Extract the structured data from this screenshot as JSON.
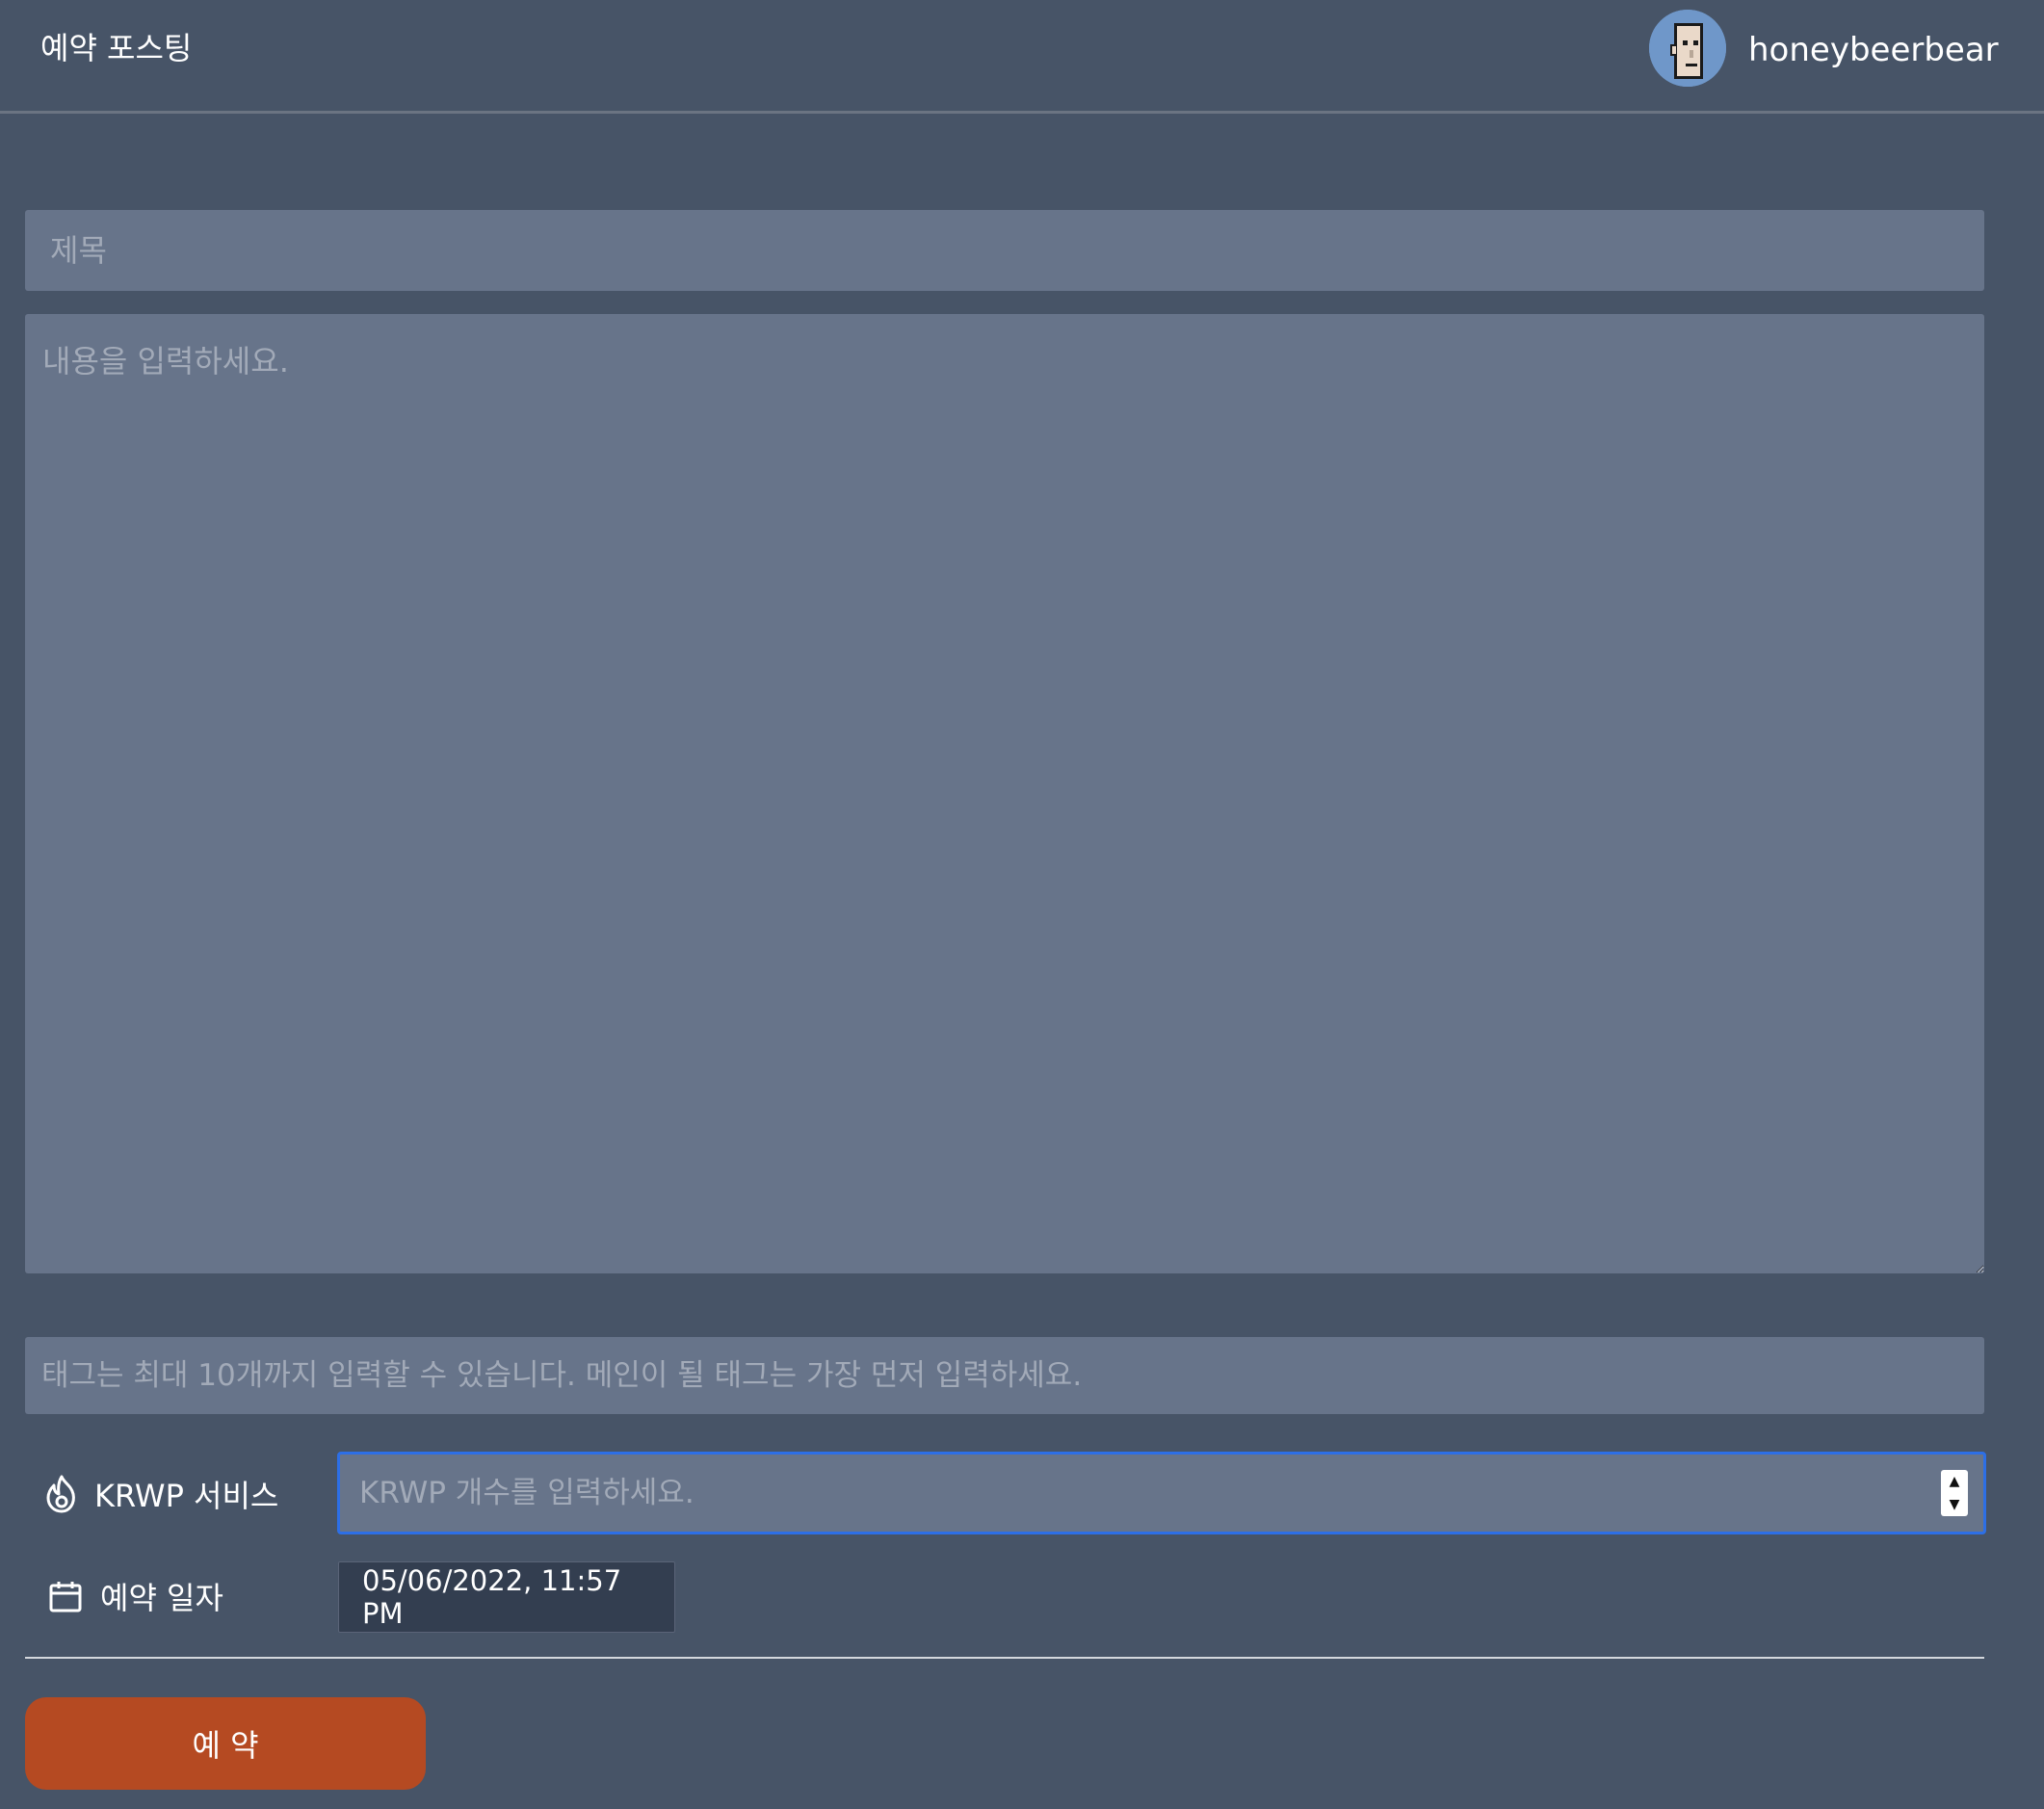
{
  "header": {
    "title": "예약 포스팅",
    "username": "honeybeerbear"
  },
  "form": {
    "title_placeholder": "제목",
    "content_placeholder": "내용을 입력하세요.",
    "tags_placeholder": "태그는 최대 10개까지 입력할 수 있습니다. 메인이 될 태그는 가장 먼저 입력하세요.",
    "krwp": {
      "label": "KRWP 서비스",
      "icon": "fire-icon",
      "placeholder": "KRWP 개수를 입력하세요."
    },
    "schedule": {
      "label": "예약 일자",
      "icon": "calendar-icon",
      "value": "05/06/2022, 11:57 PM"
    },
    "submit_label": "예 약"
  },
  "colors": {
    "background": "#475467",
    "input_background": "#67748a",
    "focus_border": "#2d6fe6",
    "submit_button": "#b54a22",
    "date_field_background": "#333e50"
  }
}
